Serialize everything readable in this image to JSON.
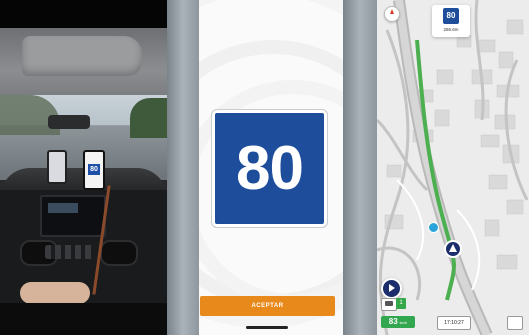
{
  "phone": {
    "sign_value": "80",
    "accept_label": "ACEPTAR",
    "sign_color": "#1d4d9b",
    "accept_color": "#e8891b"
  },
  "photo": {
    "mini_sign_value": "80"
  },
  "map": {
    "next_sign_value": "80",
    "next_sign_distance": "286.6m",
    "speed_value": "83",
    "speed_unit": "km/h",
    "speed_limit_mini": "1",
    "clock": "17:10:27",
    "route_color": "#4caf50"
  }
}
